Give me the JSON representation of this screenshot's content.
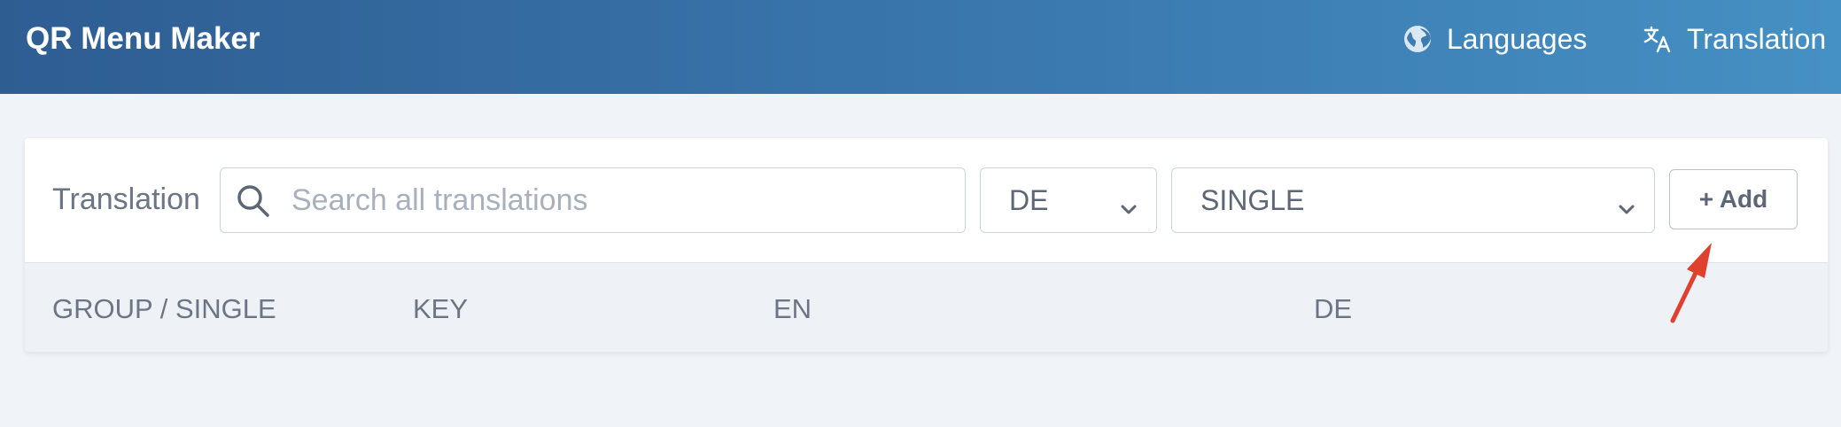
{
  "app": {
    "title": "QR Menu Maker"
  },
  "nav": {
    "items": [
      {
        "label": "Languages",
        "icon": "globe-icon"
      },
      {
        "label": "Translation",
        "icon": "translate-icon"
      }
    ]
  },
  "toolbar": {
    "label": "Translation",
    "search": {
      "placeholder": "Search all translations",
      "value": ""
    },
    "language_select": {
      "value": "DE"
    },
    "mode_select": {
      "value": "SINGLE"
    },
    "add_label": "+ Add"
  },
  "table": {
    "columns": [
      "GROUP / SINGLE",
      "KEY",
      "EN",
      "DE"
    ]
  },
  "colors": {
    "header_start": "#2e5d92",
    "header_end": "#4590c4",
    "background": "#f0f3f7",
    "annotation_arrow": "#e0412f"
  }
}
